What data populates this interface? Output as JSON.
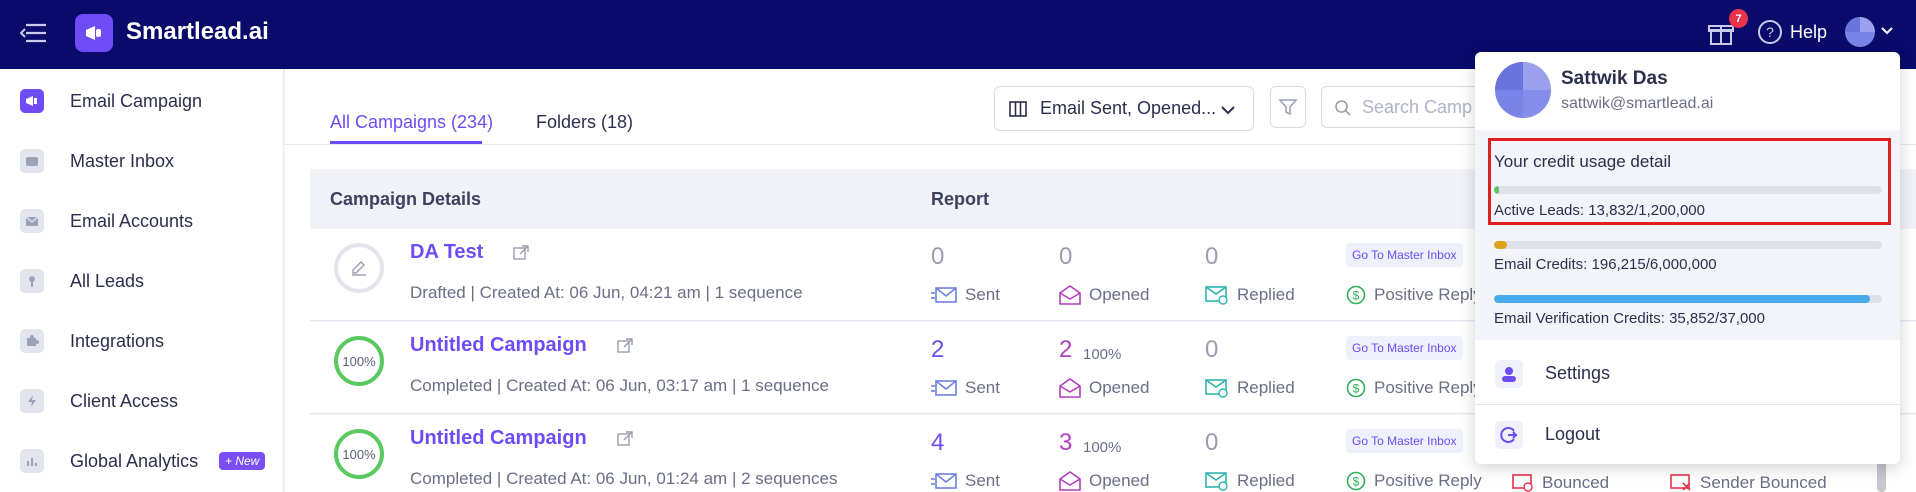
{
  "app": {
    "brand": "Smartlead.ai",
    "gift_count": "7",
    "help_label": "Help"
  },
  "sidebar": {
    "items": [
      {
        "label": "Email Campaign",
        "icon": "megaphone-icon",
        "active": true
      },
      {
        "label": "Master Inbox",
        "icon": "inbox-icon"
      },
      {
        "label": "Email Accounts",
        "icon": "envelope-icon"
      },
      {
        "label": "All Leads",
        "icon": "leads-icon"
      },
      {
        "label": "Integrations",
        "icon": "puzzle-icon"
      },
      {
        "label": "Client Access",
        "icon": "bolt-icon"
      },
      {
        "label": "Global Analytics",
        "icon": "bar-chart-icon",
        "badge": "+ New"
      }
    ]
  },
  "tabs": [
    {
      "label": "All Campaigns (234)",
      "active": true
    },
    {
      "label": "Folders (18)"
    }
  ],
  "toolbar": {
    "columns_select": "Email Sent, Opened...",
    "search_placeholder": "Search Campa"
  },
  "table": {
    "headers": {
      "details": "Campaign Details",
      "report": "Report"
    },
    "rows": [
      {
        "status": "",
        "name": "DA Test",
        "meta": "Drafted | Created At: 06 Jun, 04:21 am | 1 sequence",
        "sent": "0",
        "opened": "0",
        "opened_pct": "",
        "replied": "0",
        "goto": "Go To Master Inbox",
        "positive": "Positive Reply"
      },
      {
        "status": "100%",
        "name": "Untitled Campaign",
        "meta": "Completed | Created At: 06 Jun, 03:17 am | 1 sequence",
        "sent": "2",
        "opened": "2",
        "opened_pct": "100%",
        "replied": "0",
        "goto": "Go To Master Inbox",
        "positive": "Positive Reply"
      },
      {
        "status": "100%",
        "name": "Untitled Campaign",
        "meta": "Completed | Created At: 06 Jun, 01:24 am | 2 sequences",
        "sent": "4",
        "opened": "3",
        "opened_pct": "100%",
        "replied": "0",
        "goto": "Go To Master Inbox",
        "positive": "Positive Reply"
      }
    ],
    "labels": {
      "sent": "Sent",
      "opened": "Opened",
      "replied": "Replied",
      "bounced": "Bounced",
      "sender_bounced": "Sender Bounced"
    }
  },
  "user_menu": {
    "name": "Sattwik Das",
    "email": "sattwik@smartlead.ai",
    "credit_title": "Your credit usage detail",
    "credits": [
      {
        "label": "Active Leads: 13,832/1,200,000",
        "used": 0.0115,
        "color": "#5ac95f"
      },
      {
        "label": "Email Credits: 196,215/6,000,000",
        "used": 0.033,
        "color": "#e0a21a"
      },
      {
        "label": "Email Verification Credits: 35,852/37,000",
        "used": 0.969,
        "color": "#4aa9e9"
      }
    ],
    "items": [
      {
        "label": "Settings",
        "icon": "person-icon"
      },
      {
        "label": "Logout",
        "icon": "logout-icon"
      }
    ]
  }
}
